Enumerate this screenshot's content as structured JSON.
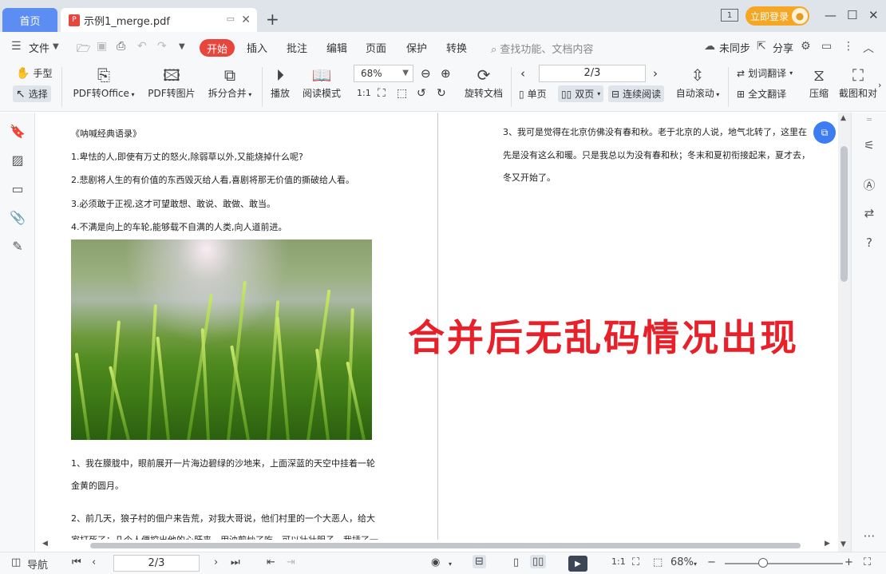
{
  "titlebar": {
    "home_tab": "首页",
    "doc_tab": "示例1_merge.pdf",
    "login": "立即登录",
    "badge_num": "1"
  },
  "menu": {
    "file": "文件",
    "start": "开始",
    "items": [
      "插入",
      "批注",
      "编辑",
      "页面",
      "保护",
      "转换"
    ],
    "search_placeholder": "查找功能、文档内容",
    "sync": "未同步",
    "share": "分享"
  },
  "ribbon": {
    "hand": "手型",
    "select": "选择",
    "pdf_to_office": "PDF转Office",
    "pdf_to_image": "PDF转图片",
    "split_merge": "拆分合并",
    "play": "播放",
    "read_mode": "阅读模式",
    "zoom": "68%",
    "rotate_doc": "旋转文档",
    "page_value": "2/3",
    "single_page": "单页",
    "double_page": "双页",
    "continuous": "连续阅读",
    "auto_scroll": "自动滚动",
    "word_translate": "划词翻译",
    "full_translate": "全文翻译",
    "compress": "压缩",
    "screenshot": "截图和对"
  },
  "document": {
    "left_lines": [
      "《呐喊经典语录》",
      "1.卑怯的人,即使有万丈的怒火,除弱草以外,又能烧掉什么呢?",
      "2.悲剧将人生的有价值的东西毁灭给人看,喜剧将那无价值的撕破给人看。",
      "3.必须敢于正视,这才可望敢想、敢说、敢做、敢当。",
      "4.不满是向上的车轮,能够载不自满的人类,向人道前进。"
    ],
    "left_para1": [
      "1、我在朦胧中，眼前展开一片海边碧绿的沙地来，上面深蓝的天空中挂着一轮",
      "金黄的圆月。"
    ],
    "left_para2": [
      "2、前几天，狼子村的佃户来告荒，对我大哥说，他们村里的一个大恶人，给大",
      "家打死了；几个人便挖出他的心肝来，用油煎炒了吃，可以壮壮胆子。我插了一"
    ],
    "right_lines": [
      "3、我可是觉得在北京仿佛没有春和秋。老于北京的人说，地气北转了，这里在",
      "先是没有这么和暖。只是我总以为没有春和秋；冬末和夏初衔接起来，夏才去，",
      "冬又开始了。"
    ],
    "overlay_caption": "合并后无乱码情况出现"
  },
  "statusbar": {
    "nav": "导航",
    "page_value": "2/3",
    "zoom": "68%"
  },
  "colors": {
    "accent_red": "#e8453c",
    "home_tab_blue": "#5b8df3",
    "login_orange": "#f5a623",
    "caption_red": "#e8202a"
  }
}
